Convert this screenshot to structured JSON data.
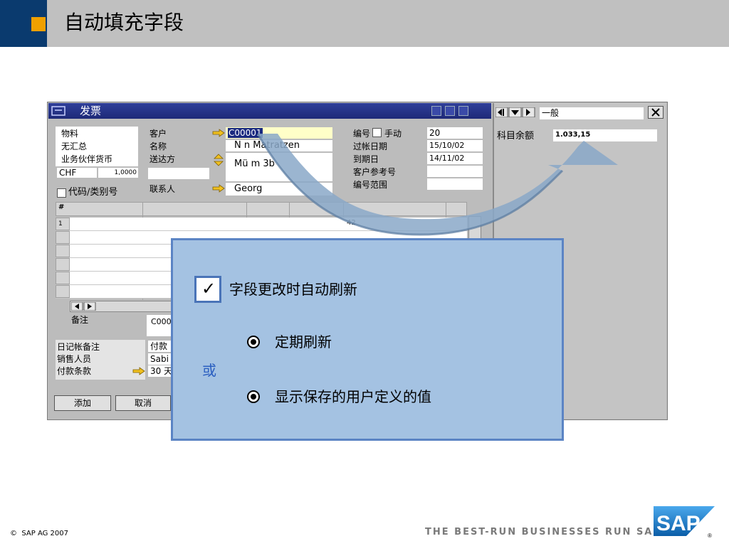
{
  "slide": {
    "title": "自动填充字段"
  },
  "window": {
    "title": "发票"
  },
  "left_panel": {
    "items": [
      "物料",
      "无汇总",
      "业务伙伴货币"
    ],
    "currency": "CHF",
    "rate": "1,0000",
    "checkbox_label": "代码/类别号"
  },
  "customer": {
    "labels": {
      "customer": "客户",
      "name": "名称",
      "ship_to": "送达方",
      "contact": "联系人"
    },
    "values": {
      "customer": "C00001",
      "name": "N         n Matratzen",
      "ship_to": "Mü          m 3b",
      "contact": "Georg"
    }
  },
  "doc": {
    "labels": {
      "number": "编号",
      "manual": "手动",
      "posting_date": "过帐日期",
      "due_date": "到期日",
      "customer_ref": "客户参考号",
      "number_range": "编号范围"
    },
    "values": {
      "number": "20",
      "posting_date": "15/10/02",
      "due_date": "14/11/02"
    }
  },
  "grid": {
    "header": "#",
    "row1": "1",
    "cell_value": "42"
  },
  "bottom": {
    "labels": {
      "remarks": "备注",
      "journal_remark": "日记帐备注",
      "sales_employee": "销售人员",
      "payment_terms": "付款条款"
    },
    "values": {
      "remarks": "C000",
      "payment": "付款",
      "sales_employee": "Sabi",
      "payment_terms": "30 天"
    }
  },
  "buttons": {
    "add": "添加",
    "cancel": "取消"
  },
  "right_panel": {
    "dropdown": "一般",
    "label": "科目余额",
    "value": "1.033,15"
  },
  "overlay": {
    "checkbox_label": "字段更改时自动刷新",
    "option1": "定期刷新",
    "or": "或",
    "option2": "显示保存的用户定义的值"
  },
  "footer": {
    "copyright": "SAP AG 2007",
    "tagline": "THE BEST-RUN BUSINESSES RUN SAP",
    "logo": "SAP"
  },
  "colors": {
    "navy": "#0a3a6e",
    "orange": "#f0a000",
    "overlay": "#a4c2e2",
    "overlay_border": "#5b84c4",
    "sap_blue": "#1a7ac8"
  }
}
